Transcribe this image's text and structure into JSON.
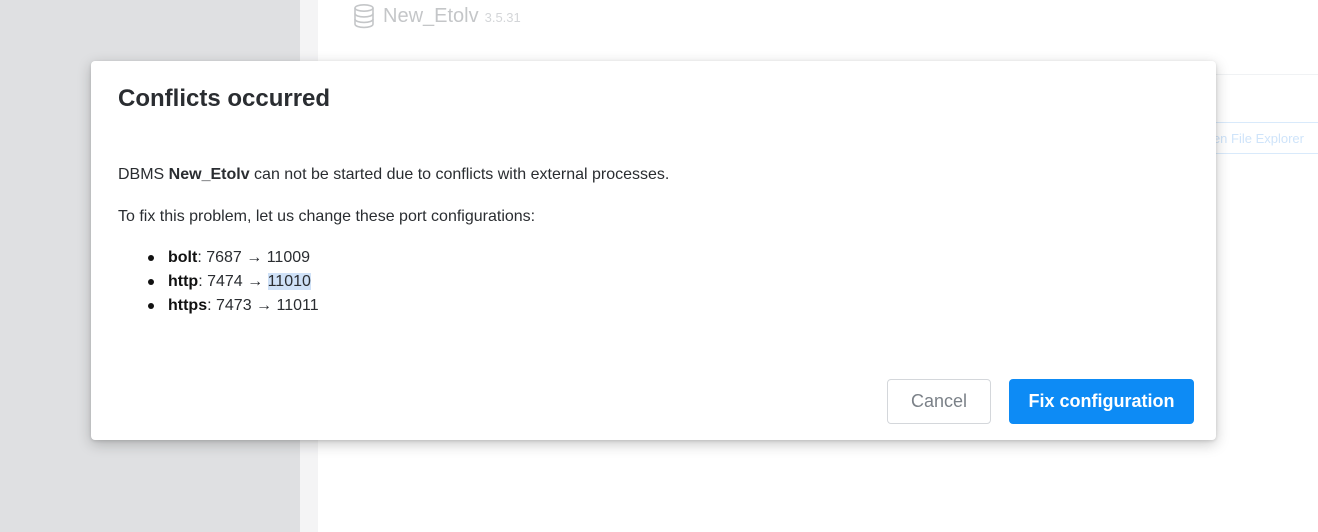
{
  "background": {
    "db_name": "New_Etolv",
    "db_version": "3.5.31",
    "partial_button_label": "Open File Explorer"
  },
  "dialog": {
    "title": "Conflicts occurred",
    "message_prefix": "DBMS ",
    "message_db": "New_Etolv",
    "message_suffix": " can not be started due to conflicts with external processes.",
    "instruction": "To fix this problem, let us change these port configurations:",
    "ports": [
      {
        "name": "bolt",
        "from": "7687",
        "to": "11009"
      },
      {
        "name": "http",
        "from": "7474",
        "to": "11010"
      },
      {
        "name": "https",
        "from": "7473",
        "to": "11011"
      }
    ],
    "arrow": "→",
    "cancel_label": "Cancel",
    "fix_label": "Fix configuration"
  },
  "colors": {
    "primary": "#0d8bf5",
    "left_pane": "#dfe0e2",
    "selection": "#cfe1f7"
  }
}
